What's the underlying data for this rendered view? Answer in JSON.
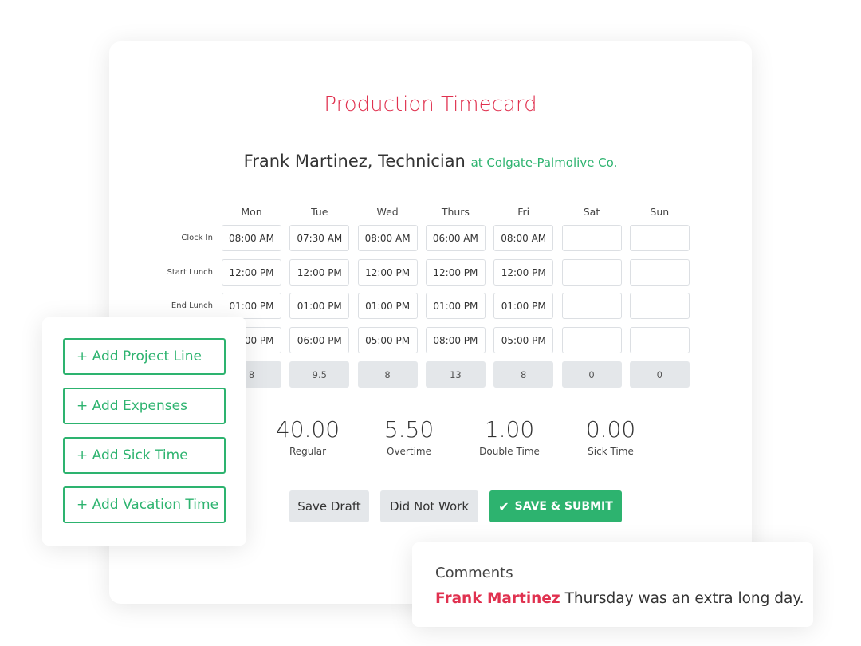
{
  "title": "Production Timecard",
  "employee": {
    "name": "Frank Martinez, Technician",
    "company": "at Colgate-Palmolive Co."
  },
  "days": [
    "Mon",
    "Tue",
    "Wed",
    "Thurs",
    "Fri",
    "Sat",
    "Sun"
  ],
  "rows": [
    {
      "label": "Clock In",
      "values": [
        "08:00 AM",
        "07:30 AM",
        "08:00 AM",
        "06:00 AM",
        "08:00 AM",
        "",
        ""
      ]
    },
    {
      "label": "Start Lunch",
      "values": [
        "12:00 PM",
        "12:00 PM",
        "12:00 PM",
        "12:00 PM",
        "12:00 PM",
        "",
        ""
      ]
    },
    {
      "label": "End Lunch",
      "values": [
        "01:00 PM",
        "01:00 PM",
        "01:00 PM",
        "01:00 PM",
        "01:00 PM",
        "",
        ""
      ]
    },
    {
      "label": "",
      "values": [
        "05:00 PM",
        "06:00 PM",
        "05:00 PM",
        "08:00 PM",
        "05:00 PM",
        "",
        ""
      ]
    }
  ],
  "totals": [
    "8",
    "9.5",
    "8",
    "13",
    "8",
    "0",
    "0"
  ],
  "summary": [
    {
      "value": "40.00",
      "label": "Regular"
    },
    {
      "value": "5.50",
      "label": "Overtime"
    },
    {
      "value": "1.00",
      "label": "Double Time"
    },
    {
      "value": "0.00",
      "label": "Sick Time"
    }
  ],
  "buttons": {
    "save_draft": "Save Draft",
    "did_not_work": "Did Not Work",
    "save_submit": "SAVE & SUBMIT"
  },
  "add_actions": [
    "+ Add Project Line",
    "+ Add Expenses",
    "+ Add Sick Time",
    "+ Add Vacation Time"
  ],
  "comments": {
    "heading": "Comments",
    "author": "Frank Martinez",
    "text": "Thursday was an extra long day."
  },
  "colors": {
    "accent_red": "#e0314f",
    "accent_green": "#2db36f"
  }
}
